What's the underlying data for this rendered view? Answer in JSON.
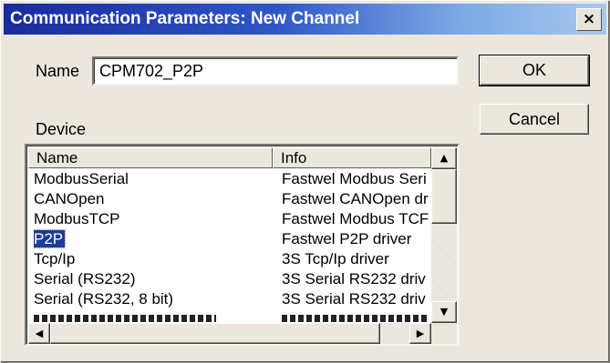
{
  "window": {
    "title": "Communication Parameters: New Channel",
    "close_glyph": "×"
  },
  "form": {
    "name_label": "Name",
    "name_value": "CPM702_P2P",
    "device_label": "Device"
  },
  "buttons": {
    "ok": "OK",
    "cancel": "Cancel"
  },
  "device_list": {
    "columns": [
      "Name",
      "Info"
    ],
    "selected_index": 3,
    "rows": [
      {
        "name": "ModbusSerial",
        "info": "Fastwel Modbus Seri"
      },
      {
        "name": "CANOpen",
        "info": "Fastwel CANOpen dr"
      },
      {
        "name": "ModbusTCP",
        "info": "Fastwel Modbus TCF"
      },
      {
        "name": "P2P",
        "info": "Fastwel P2P driver"
      },
      {
        "name": "Tcp/Ip",
        "info": "3S Tcp/Ip driver"
      },
      {
        "name": "Serial (RS232)",
        "info": "3S Serial RS232 driv"
      },
      {
        "name": "Serial (RS232, 8 bit)",
        "info": "3S Serial RS232 driv"
      }
    ],
    "scroll_icons": {
      "up": "▲",
      "down": "▼",
      "left": "◀",
      "right": "▶"
    }
  }
}
